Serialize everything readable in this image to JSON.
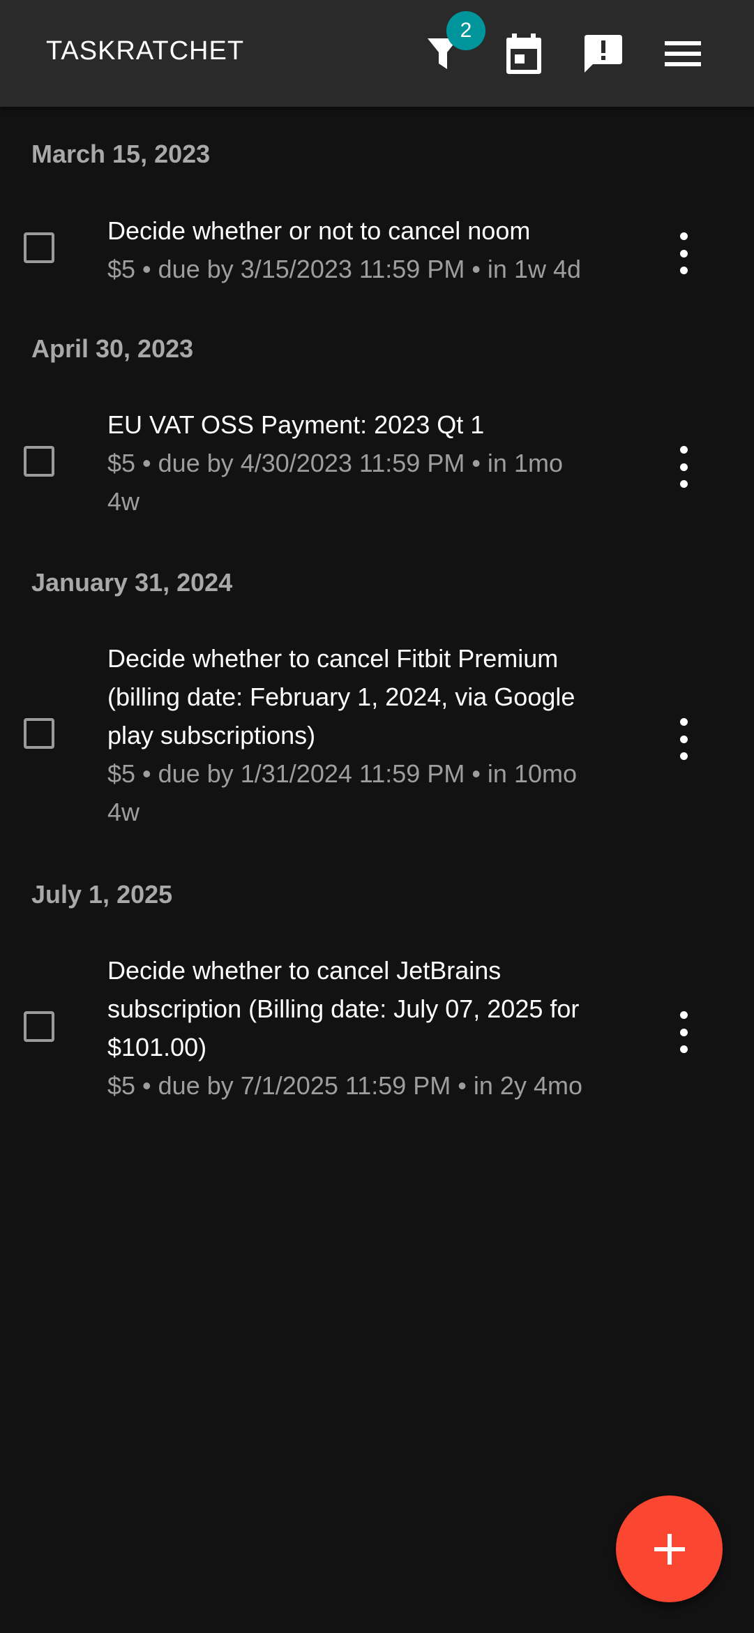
{
  "appbar": {
    "title": "TASKRATCHET",
    "filter_badge": "2"
  },
  "icons": {
    "filter": "filter-icon",
    "calendar": "calendar-icon",
    "feedback": "feedback-icon",
    "menu": "menu-icon",
    "more": "more-vert-icon",
    "add": "add-icon"
  },
  "colors": {
    "appbar_bg": "#2a2a2a",
    "background": "#121212",
    "badge": "#00959a",
    "fab": "#fb4631"
  },
  "groups": [
    {
      "date": "March 15, 2023",
      "tasks": [
        {
          "title_lines": [
            "Decide whether or not to cancel noom"
          ],
          "meta_lines": [
            "$5 • due by 3/15/2023 11:59 PM • in 1w 4d"
          ]
        }
      ]
    },
    {
      "date": "April 30, 2023",
      "tasks": [
        {
          "title_lines": [
            "EU VAT OSS Payment: 2023 Qt 1"
          ],
          "meta_lines": [
            "$5 • due by 4/30/2023 11:59 PM • in 1mo",
            "4w"
          ]
        }
      ]
    },
    {
      "date": "January 31, 2024",
      "tasks": [
        {
          "title_lines": [
            "Decide whether to cancel Fitbit Premium",
            "(billing date: February 1, 2024, via Google",
            "play subscriptions)"
          ],
          "meta_lines": [
            "$5 • due by 1/31/2024 11:59 PM • in 10mo",
            "4w"
          ]
        }
      ]
    },
    {
      "date": "July 1, 2025",
      "tasks": [
        {
          "title_lines": [
            "Decide whether to cancel JetBrains",
            "subscription (Billing date: July 07, 2025 for",
            "$101.00)"
          ],
          "meta_lines": [
            "$5 • due by 7/1/2025 11:59 PM • in 2y 4mo"
          ]
        }
      ]
    }
  ]
}
